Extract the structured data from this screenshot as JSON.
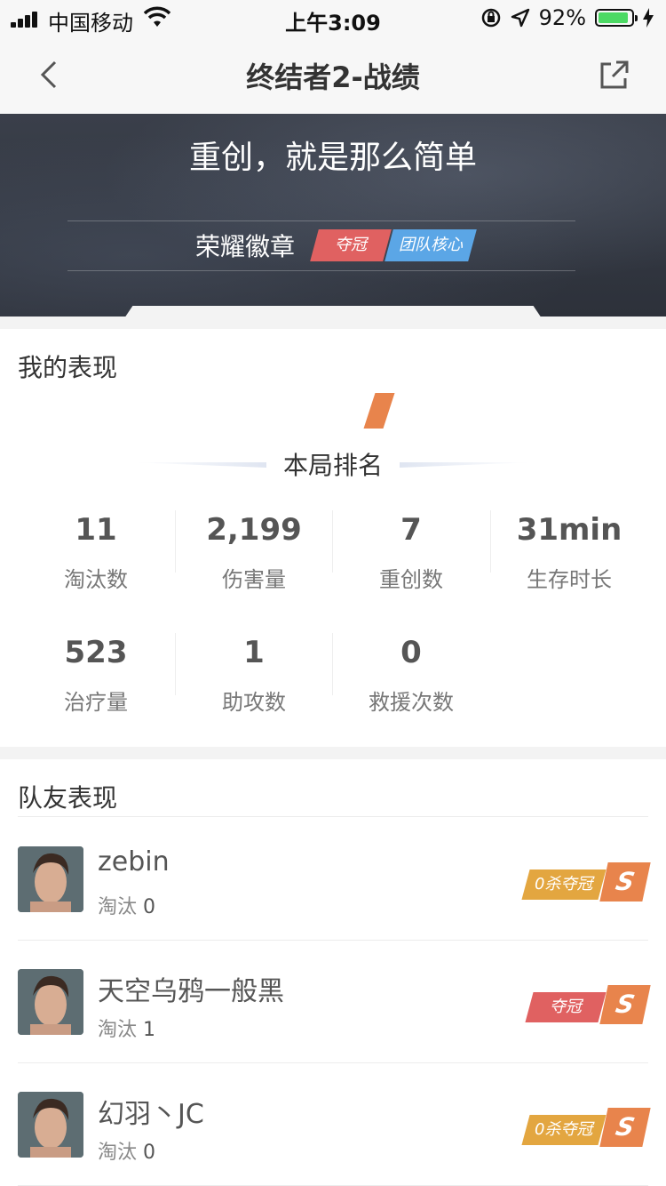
{
  "status_bar": {
    "carrier": "中国移动",
    "time": "上午3:09",
    "battery_percent": "92%",
    "battery_level": 0.92
  },
  "nav": {
    "title": "终结者2-战绩"
  },
  "banner": {
    "slogan": "重创，就是那么简单",
    "badge_label": "荣耀徽章",
    "badges": [
      {
        "text": "夺冠",
        "color": "#e06161"
      },
      {
        "text": "团队核心",
        "color": "#5ba6e6"
      }
    ]
  },
  "performance": {
    "heading": "我的表现",
    "rank_label": "本局排名",
    "stats_row1": [
      {
        "value": "11",
        "label": "淘汰数"
      },
      {
        "value": "2,199",
        "label": "伤害量"
      },
      {
        "value": "7",
        "label": "重创数"
      },
      {
        "value": "31min",
        "label": "生存时长"
      }
    ],
    "stats_row2": [
      {
        "value": "523",
        "label": "治疗量"
      },
      {
        "value": "1",
        "label": "助攻数"
      },
      {
        "value": "0",
        "label": "救援次数"
      }
    ]
  },
  "team": {
    "heading": "队友表现",
    "elim_label": "淘汰",
    "members": [
      {
        "name": "zebin",
        "eliminations": "0",
        "tag": "0杀夺冠",
        "tag_color": "#e3a640",
        "grade": "S"
      },
      {
        "name": "天空乌鸦一般黑",
        "eliminations": "1",
        "tag": "夺冠",
        "tag_color": "#e06161",
        "grade": "S"
      },
      {
        "name": "幻羽丶JC",
        "eliminations": "0",
        "tag": "0杀夺冠",
        "tag_color": "#e3a640",
        "grade": "S"
      }
    ]
  }
}
